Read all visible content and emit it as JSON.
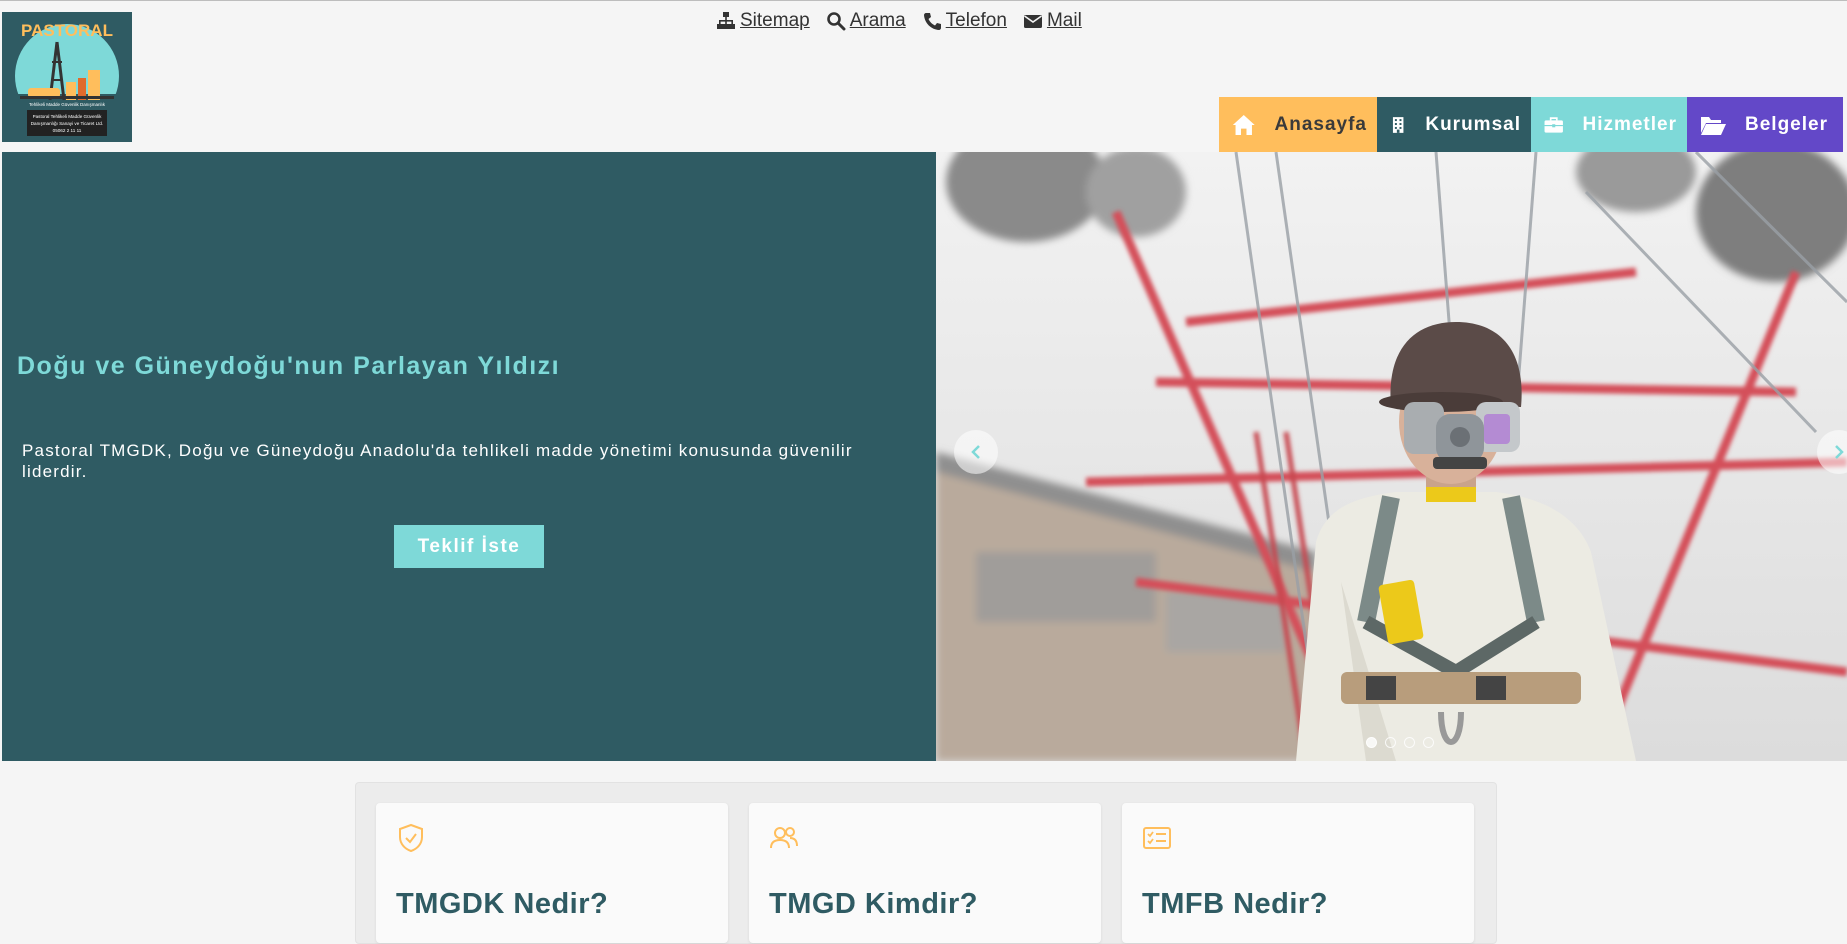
{
  "logo": {
    "title": "PASTORAL",
    "tagline": "Tehlikeli Madde Güvenlik Danışmanlık",
    "caption_line1": "Pastoral Tehlikeli Madde Güvenlik",
    "caption_line2": "Danışmanlığı Sanayi ve Ticaret Ltd.",
    "phone": "05062 2 11 11"
  },
  "toplinks": [
    {
      "label": " Sitemap",
      "icon": "sitemap-icon"
    },
    {
      "label": " Arama",
      "icon": "search-icon"
    },
    {
      "label": "Telefon ",
      "icon": "phone-icon"
    },
    {
      "label": " Mail",
      "icon": "mail-icon"
    }
  ],
  "nav": [
    {
      "label": "Anasayfa",
      "icon": "home-icon",
      "color": "#ffbe5c"
    },
    {
      "label": "Kurumsal",
      "icon": "building-icon",
      "color": "#2f5b63"
    },
    {
      "label": "Hizmetler",
      "icon": "briefcase-icon",
      "color": "#7ed9d8"
    },
    {
      "label": "Belgeler",
      "icon": "folder-open-icon",
      "color": "#6348c8"
    }
  ],
  "hero": {
    "title": "Doğu ve Güneydoğu'nun Parlayan Yıldızı",
    "text": "Pastoral TMGDK, Doğu ve Güneydoğu Anadolu'da tehlikeli madde yönetimi konusunda güvenilir liderdir.",
    "cta": "Teklif İste",
    "slides": 4,
    "active_slide": 1
  },
  "cards": [
    {
      "title": "TMGDK Nedir?",
      "icon": "shield-check-icon"
    },
    {
      "title": "TMGD Kimdir?",
      "icon": "users-icon"
    },
    {
      "title": "TMFB Nedir?",
      "icon": "list-card-icon"
    }
  ],
  "colors": {
    "teal_dark": "#2f5b63",
    "teal_light": "#7ed9d8",
    "orange": "#ffbe5c",
    "purple": "#6348c8"
  }
}
